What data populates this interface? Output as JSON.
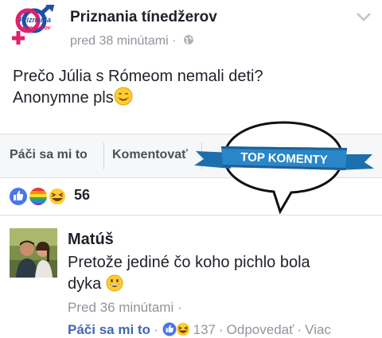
{
  "post": {
    "page_name": "Priznania tínedžerov",
    "time": "pred 38 minútami",
    "meta_separator": "·",
    "avatar_logo_line1": "Priznania",
    "avatar_logo_line2": "tínedžerov",
    "body_line1": "Prečo Júlia s Rómeom nemali deti?",
    "body_line2": "Anonymne pls",
    "icons": {
      "more": "chevron-down-icon",
      "privacy": "globe-icon",
      "emoji": "smiling-face-emoji"
    }
  },
  "actions": {
    "like": "Páči sa mi to",
    "comment": "Komentovať"
  },
  "reactions": {
    "count": "56",
    "types": [
      "like-reaction",
      "pride-reaction",
      "haha-reaction"
    ]
  },
  "badge": {
    "label": "TOP KOMENTY"
  },
  "comment": {
    "author": "Matúš",
    "text_line1": "Pretože jediné čo koho pichlo bola",
    "text_line2": "dyka",
    "time": "Pred 36 minútami",
    "time_separator": "·",
    "like": "Páči sa mi to",
    "reaction_count": "137",
    "reply": "Odpovedať",
    "more": "Viac",
    "separator": "·"
  },
  "colors": {
    "text": "#1d2129",
    "muted": "#90949c",
    "fb_blue": "#4267b2",
    "ribbon_blue": "#2a86c8",
    "action_bar_bg": "#f6f7f9"
  }
}
